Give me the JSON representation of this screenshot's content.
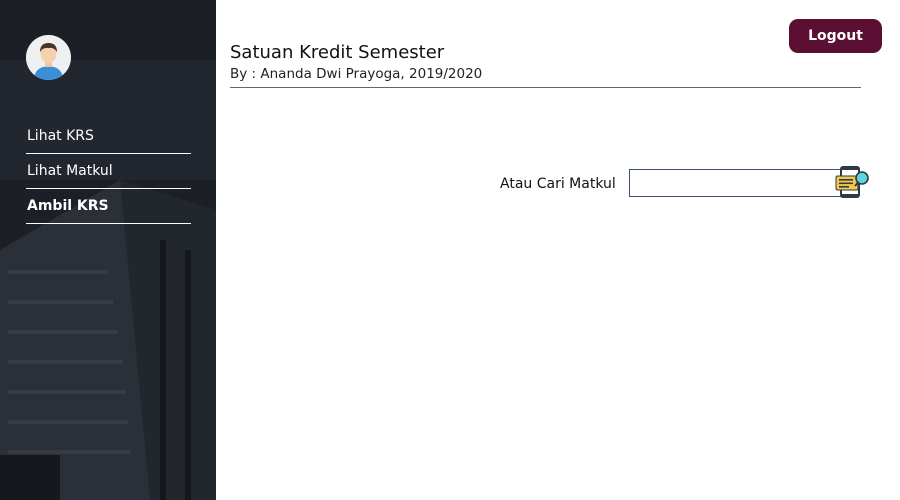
{
  "sidebar": {
    "avatar_icon": "user-avatar-icon",
    "items": [
      {
        "label": "Lihat KRS",
        "active": false
      },
      {
        "label": "Lihat Matkul",
        "active": false
      },
      {
        "label": "Ambil KRS",
        "active": true
      }
    ]
  },
  "header": {
    "title": "Satuan Kredit Semester",
    "subtitle": "By : Ananda Dwi Prayoga, 2019/2020"
  },
  "logout": {
    "label": "Logout"
  },
  "search": {
    "label": "Atau Cari Matkul",
    "value": "",
    "placeholder": "",
    "icon": "search-document-icon"
  },
  "colors": {
    "accent": "#5a0f33",
    "sidebar_bg": "#1f2329",
    "input_border": "#3a4f7a"
  }
}
